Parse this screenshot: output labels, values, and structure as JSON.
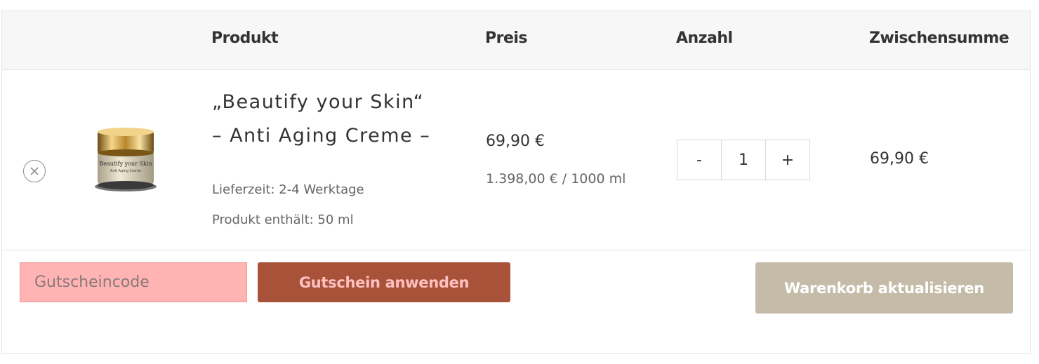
{
  "table": {
    "headers": {
      "product": "Produkt",
      "price": "Preis",
      "quantity": "Anzahl",
      "subtotal": "Zwischensumme"
    }
  },
  "item": {
    "name_line1": "„Beautify your Skin“",
    "name_line2": "– Anti Aging Creme –",
    "delivery": "Lieferzeit: 2-4 Werktage",
    "contents": "Produkt enthält: 50 ml",
    "price": "69,90 €",
    "unit_price": "1.398,00 € / 1000 ml",
    "quantity": "1",
    "subtotal": "69,90 €",
    "image_label_line1": "Beautify your Skin",
    "image_label_line2": "Anti Aging Creme"
  },
  "qty_controls": {
    "minus": "-",
    "plus": "+"
  },
  "coupon": {
    "placeholder": "Gutscheincode",
    "apply_label": "Gutschein anwenden"
  },
  "update_cart_label": "Warenkorb aktualisieren",
  "icons": {
    "remove": "remove-circle-x-icon"
  },
  "colors": {
    "coupon_input_bg": "#ffb3b3",
    "coupon_button_bg": "#a8523a",
    "coupon_button_text": "#ffc0c0",
    "update_button_bg": "#c4bca8"
  }
}
